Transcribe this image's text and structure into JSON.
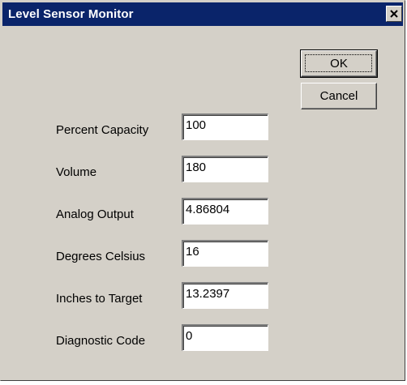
{
  "window": {
    "title": "Level Sensor Monitor"
  },
  "buttons": {
    "ok_label": "OK",
    "cancel_label": "Cancel"
  },
  "fields": [
    {
      "label": "Percent Capacity",
      "value": "100"
    },
    {
      "label": "Volume",
      "value": "180"
    },
    {
      "label": "Analog Output",
      "value": "4.86804"
    },
    {
      "label": "Degrees Celsius",
      "value": "16"
    },
    {
      "label": "Inches to Target",
      "value": "13.2397"
    },
    {
      "label": "Diagnostic Code",
      "value": "0"
    }
  ],
  "icons": {
    "close": "close-icon"
  }
}
